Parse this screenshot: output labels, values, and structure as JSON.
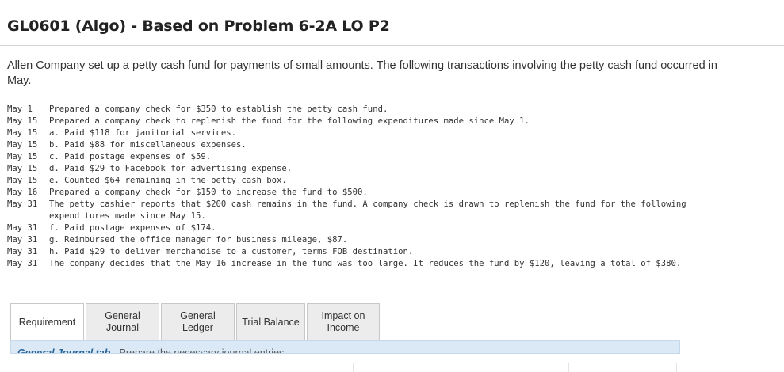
{
  "header": {
    "title": "GL0601 (Algo) - Based on Problem 6-2A LO P2"
  },
  "intro": "Allen Company set up a petty cash fund for payments of small amounts. The following transactions involving the petty cash fund occurred in May.",
  "transactions": [
    {
      "date": "May 1",
      "text": "Prepared a company check for $350 to establish the petty cash fund."
    },
    {
      "date": "May 15",
      "text": "Prepared a company check to replenish the fund for the following expenditures made since May 1."
    },
    {
      "date": "May 15",
      "text": "a. Paid $118 for janitorial services."
    },
    {
      "date": "May 15",
      "text": "b. Paid $88 for miscellaneous expenses."
    },
    {
      "date": "May 15",
      "text": "c. Paid postage expenses of $59."
    },
    {
      "date": "May 15",
      "text": "d. Paid $29 to Facebook for advertising expense."
    },
    {
      "date": "May 15",
      "text": "e. Counted $64 remaining in the petty cash box."
    },
    {
      "date": "May 16",
      "text": "Prepared a company check for $150 to increase the fund to $500."
    },
    {
      "date": "May 31",
      "text": "The petty cashier reports that $200 cash remains in the fund. A company check is drawn to replenish the fund for the following expenditures made since May 15."
    },
    {
      "date": "May 31",
      "text": "f. Paid postage expenses of $174."
    },
    {
      "date": "May 31",
      "text": "g. Reimbursed the office manager for business mileage, $87."
    },
    {
      "date": "May 31",
      "text": "h. Paid $29 to deliver merchandise to a customer, terms FOB destination."
    },
    {
      "date": "May 31",
      "text": "The company decides that the May 16 increase in the fund was too large. It reduces the fund by $120, leaving a total of $380."
    }
  ],
  "tabs": [
    {
      "label": "Requirement",
      "active": true
    },
    {
      "label": "General\nJournal",
      "active": false
    },
    {
      "label": "General\nLedger",
      "active": false
    },
    {
      "label": "Trial Balance",
      "active": false
    },
    {
      "label": "Impact on\nIncome",
      "active": false
    }
  ],
  "tab_panel": {
    "tab_name": "General Journal tab",
    "instruction": "- Prepare the necessary journal entries."
  },
  "colors": {
    "active_tab_bg": "#ffffff",
    "tab_bg": "#ececec",
    "panel_bg": "#dbe9f6",
    "link": "#2a6496"
  }
}
